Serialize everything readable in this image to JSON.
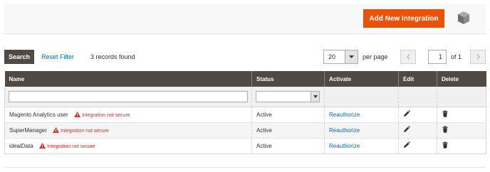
{
  "header": {
    "add_button_label": "Add New Integration",
    "cube_icon": "cube-icon"
  },
  "toolbar": {
    "search_label": "Search",
    "reset_filter_label": "Reset Filter",
    "records_found": "3 records found",
    "per_page_value": "20",
    "per_page_label": "per page",
    "current_page": "1",
    "total_pages_label": "of 1"
  },
  "grid": {
    "columns": [
      "Name",
      "Status",
      "Activate",
      "Edit",
      "Delete"
    ],
    "rows": [
      {
        "name": "Magento Analytics user",
        "warning": "Integration not secure",
        "status": "Active",
        "activate": "Reauthorize"
      },
      {
        "name": "SuperManager",
        "warning": "Integration not secure",
        "status": "Active",
        "activate": "Reauthorize"
      },
      {
        "name": "idealData",
        "warning": "Integration not secure",
        "status": "Active",
        "activate": "Reauthorize"
      }
    ]
  },
  "colors": {
    "accent": "#eb5202",
    "header_bg": "#514943",
    "link": "#006bb4",
    "warning": "#e22626"
  }
}
